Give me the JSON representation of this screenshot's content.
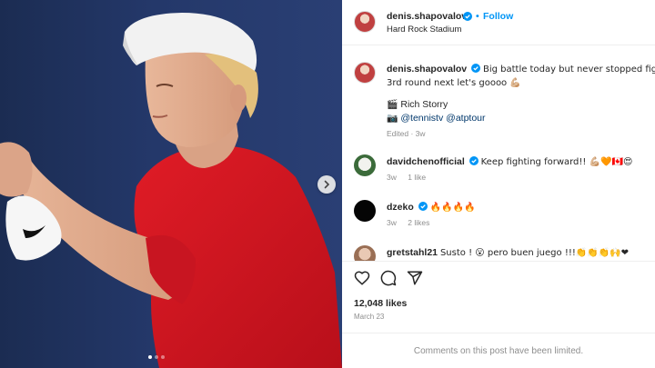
{
  "post": {
    "username": "denis.shapovalov",
    "follow_label": "Follow",
    "location": "Hard Rock Stadium",
    "caption": {
      "line1": "Big battle today but never stopped fighting 💪🏼",
      "line2": "3rd round next let's goooo 💪🏼",
      "credit_icon": "🎬",
      "credit_name": "Rich Storry",
      "camera_icon": "📷",
      "mention1": "@tennistv",
      "mention2": "@atptour",
      "edited": "Edited",
      "age": "3w"
    },
    "comments": [
      {
        "username": "davidchenofficial",
        "text": "Keep fighting forward!! 💪🏼🧡🇨🇦😍",
        "age": "3w",
        "likes": "1 like"
      },
      {
        "username": "dzeko",
        "text": "🔥🔥🔥🔥",
        "age": "3w",
        "likes": "2 likes"
      },
      {
        "username": "gretstahl21",
        "text": "Susto ! 😮 pero buen juego !!!👏👏👏🙌❤"
      }
    ],
    "likes_count": "12,048 likes",
    "date": "March 23",
    "comments_limited": "Comments on this post have been limited."
  },
  "carousel": {
    "slide_count": 3,
    "active_slide": 1
  },
  "colors": {
    "accent": "#0095f6",
    "link": "#00376b",
    "muted": "#8e8e8e",
    "shirt": "#d8141f"
  },
  "icons": [
    "verified-icon",
    "heart-icon",
    "comment-icon",
    "share-icon",
    "chevron-right-icon"
  ]
}
